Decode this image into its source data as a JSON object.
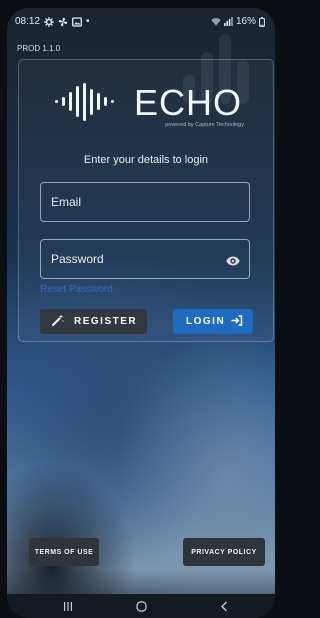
{
  "status_bar": {
    "time": "08:12",
    "dot": "•",
    "battery": "16%",
    "icons": [
      "settings-icon",
      "fan-icon",
      "image-icon",
      "wifi-icon",
      "signal-icon",
      "battery-icon"
    ]
  },
  "app": {
    "version": "PROD 1.1.0",
    "brand": "ECHO",
    "powered_by": "powered by Capture Technology",
    "subtitle": "Enter your details to login"
  },
  "form": {
    "email_placeholder": "Email",
    "email_value": "",
    "password_placeholder": "Password",
    "password_value": "",
    "password_toggle_icon": "eye-icon",
    "reset_label": "Reset Password"
  },
  "actions": {
    "register_label": "REGISTER",
    "register_icon": "magic-wand-icon",
    "login_label": "LOGIN",
    "login_icon": "login-arrow-icon"
  },
  "footer": {
    "terms_label": "TERMS OF USE",
    "privacy_label": "PRIVACY POLICY"
  },
  "nav": {
    "icons": [
      "recents-icon",
      "home-icon",
      "back-icon"
    ]
  },
  "colors": {
    "primary": "#1e6bbf",
    "link": "#2f6ac4",
    "dark_button": "#323840"
  }
}
